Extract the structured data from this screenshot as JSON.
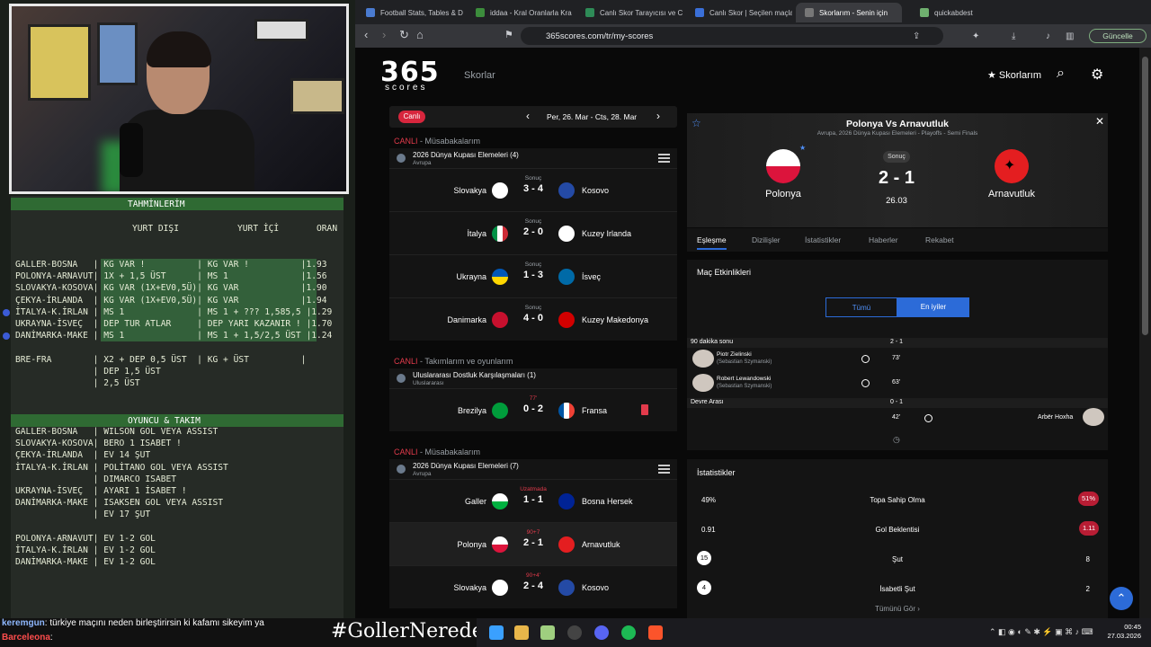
{
  "overlay": {
    "tahmin_title": "TAHMİNLERİM",
    "col_headers": {
      "yurt_disi": "YURT DIŞI",
      "yurt_ici": "YURT İÇİ",
      "oran": "ORAN"
    },
    "tahmin_rows": [
      "GALLER-BOSNA   | KG VAR !          | KG VAR !          |1.93",
      "POLONYA-ARNAVUT| 1X + 1,5 ÜST      | MS 1              |1.56",
      "SLOVAKYA-KOSOVA| KG VAR (1X+EV0,5Ü)| KG VAR            |1.90",
      "ÇEKYA-İRLANDA  | KG VAR (1X+EV0,5Ü)| KG VAR            |1.94",
      "İTALYA-K.İRLAN | MS 1              | MS 1 + ??? 1,585,5 |1.29",
      "UKRAYNA-İSVEÇ  | DEP TUR ATLAR     | DEP YARI KAZANIR ! |1.70",
      "DANİMARKA-MAKE | MS 1              | MS 1 + 1,5/2,5 ÜST |1.24"
    ],
    "extra_rows": [
      "BRE-FRA        | X2 + DEP 0,5 ÜST  | KG + ÜST          |",
      "               | DEP 1,5 ÜST",
      "               | 2,5 ÜST"
    ],
    "oyuncu_title": "OYUNCU & TAKIM",
    "oyuncu_rows": [
      "GALLER-BOSNA   | WILSON GOL VEYA ASSIST",
      "SLOVAKYA-KOSOVA| BERO 1 ISABET !",
      "ÇEKYA-İRLANDA  | EV 14 ŞUT",
      "İTALYA-K.İRLAN | POLİTANO GOL VEYA ASSIST",
      "               | DIMARCO ISABET",
      "UKRAYNA-İSVEÇ  | AYARI 1 İSABET !",
      "DANİMARKA-MAKE | ISAKSEN GOL VEYA ASSIST",
      "               | EV 17 ŞUT",
      "",
      "POLONYA-ARNAVUT| EV 1-2 GOL",
      "İTALYA-K.İRLAN | EV 1-2 GOL",
      "DANİMARKA-MAKE | EV 1-2 GOL"
    ],
    "hashtag": "#GollerNerede",
    "chat": [
      {
        "user": "keremgun",
        "text": ": türkiye maçını neden birleştirirsin ki kafamı sikeyim ya",
        "color": "#8fb8ff"
      },
      {
        "user": "Barceleona",
        "text": ":",
        "color": "#ff4d4d"
      }
    ]
  },
  "browser": {
    "tabs": [
      "Football Stats, Tables & D",
      "iddaa - Kral Oranlarla Kra",
      "Canlı Skor Tarayıcısı ve Cı",
      "Canlı Skor | Seçilen maçla",
      "Skorlarım - Senin için",
      "quickabdest"
    ],
    "url": "365scores.com/tr/my-scores",
    "update_label": "Güncelle"
  },
  "site": {
    "logo": "365",
    "logo_sub": "scores",
    "nav_scores": "Skorlar",
    "my_scores": "Skorlarım",
    "live_pill": "Canlı",
    "date_range": "Per, 26. Mar - Cts, 28. Mar",
    "sections": [
      {
        "live": "CANLI",
        "rest": " - Müsabakalarım",
        "league": "2026 Dünya Kupası Elemeleri (4)",
        "region": "Avrupa"
      },
      {
        "live": "CANLI",
        "rest": " - Takımlarım ve oyunlarım",
        "league": "Uluslararası Dostluk Karşılaşmaları (1)",
        "region": "Uluslararası"
      },
      {
        "live": "CANLI",
        "rest": " - Müsabakalarım",
        "league": "2026 Dünya Kupası Elemeleri (7)",
        "region": "Avrupa"
      }
    ],
    "games1": [
      {
        "status": "Sonuç",
        "home": "Slovakya",
        "away": "Kosovo",
        "score": "3 - 4"
      },
      {
        "status": "Sonuç",
        "home": "İtalya",
        "away": "Kuzey Irlanda",
        "score": "2 - 0"
      },
      {
        "status": "Sonuç",
        "home": "Ukrayna",
        "away": "İsveç",
        "score": "1 - 3"
      },
      {
        "status": "Sonuç",
        "home": "Danimarka",
        "away": "Kuzey Makedonya",
        "score": "4 - 0"
      }
    ],
    "games2": [
      {
        "status": "77'",
        "home": "Brezilya",
        "away": "Fransa",
        "score": "0 - 2"
      }
    ],
    "games3": [
      {
        "status": "Uzatmada",
        "home": "Galler",
        "away": "Bosna Hersek",
        "score": "1 - 1"
      },
      {
        "status": "90+7",
        "home": "Polonya",
        "away": "Arnavutluk",
        "score": "2 - 1"
      },
      {
        "status": "90+4'",
        "home": "Slovakya",
        "away": "Kosovo",
        "score": "2 - 4"
      }
    ]
  },
  "match": {
    "title": "Polonya Vs Arnavutluk",
    "subtitle": "Avrupa, 2026 Dünya Kupası Elemeleri - Playoffs - Semi Finals",
    "home": "Polonya",
    "away": "Arnavutluk",
    "status": "Sonuç",
    "score": "2 - 1",
    "date": "26.03",
    "tabs": [
      "Eşleşme",
      "Dizilişler",
      "İstatistikler",
      "Haberler",
      "Rekabet"
    ],
    "events_title": "Maç Etkinlikleri",
    "filter_all": "Tümü",
    "filter_best": "En iyiler",
    "period1": {
      "label": "90 dakika sonu",
      "score": "2 - 1"
    },
    "goals": [
      {
        "player": "Piotr Zielinski",
        "assist": "(Sebastian Szymanski)",
        "minute": "73'"
      },
      {
        "player": "Robert Lewandowski",
        "assist": "(Sebastian Szymanski)",
        "minute": "63'"
      }
    ],
    "period2": {
      "label": "Devre Arası",
      "score": "0 - 1"
    },
    "away_goal": {
      "player": "Arbër Hoxha",
      "minute": "42'"
    },
    "stats_title": "İstatistikler",
    "stats": [
      {
        "name": "Topa Sahip Olma",
        "home": "49%",
        "away": "51%"
      },
      {
        "name": "Gol Beklentisi",
        "home": "0.91",
        "away": "1.11"
      },
      {
        "name": "Şut",
        "home": "15",
        "away": "8"
      },
      {
        "name": "İsabetli Şut",
        "home": "4",
        "away": "2"
      }
    ],
    "see_all": "Tümünü Gör"
  },
  "system": {
    "time": "00:45",
    "date": "27.03.2026"
  }
}
